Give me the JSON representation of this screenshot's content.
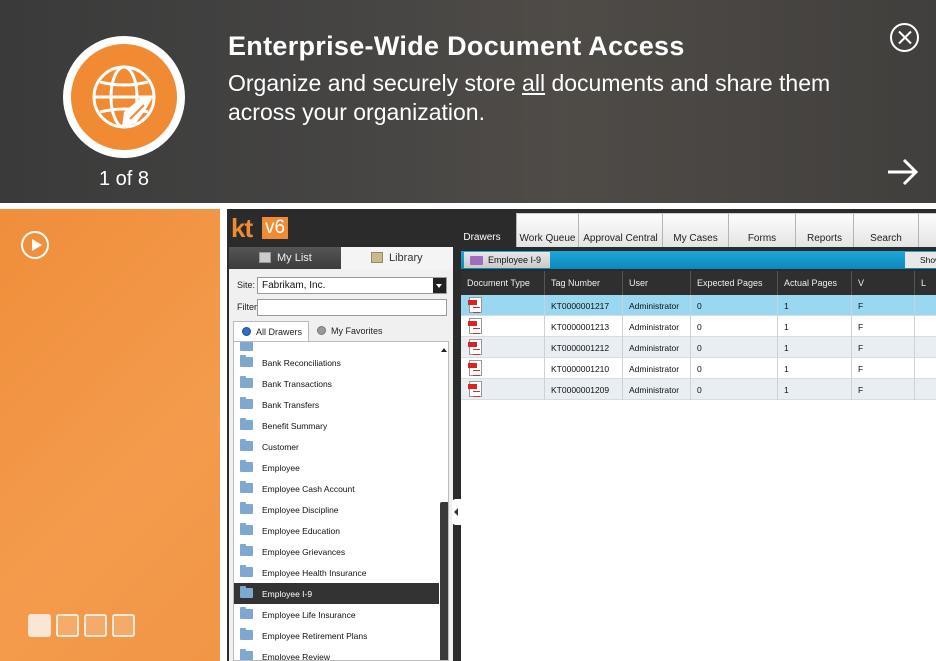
{
  "banner": {
    "title": "Enterprise-Wide Document Access",
    "subtitle_before": "Organize and securely store ",
    "subtitle_underlined": "all",
    "subtitle_after": " documents and share them across your organization.",
    "counter": "1 of 8",
    "icon": "globe-hand-icon"
  },
  "colors": {
    "accent": "#f08a33",
    "banner_bg": "#454443",
    "highlight": "#1fa6d8"
  },
  "app": {
    "logo_kt": "kt",
    "logo_version": "v6",
    "nav_tabs": [
      "Drawers",
      "Work Queue",
      "Approval Central",
      "My Cases",
      "Forms",
      "Reports",
      "Search"
    ],
    "left_tabs": [
      "My List",
      "Library"
    ],
    "site_label": "Site:",
    "site_value": "Fabrikam, Inc.",
    "filter_label": "Filter:",
    "drawer_tabs": [
      "All Drawers",
      "My Favorites"
    ],
    "drawers": [
      "Bank Reconciliations",
      "Bank Transactions",
      "Bank Transfers",
      "Benefit Summary",
      "Customer",
      "Employee",
      "Employee Cash Account",
      "Employee Discipline",
      "Employee Education",
      "Employee Grievances",
      "Employee Health Insurance",
      "Employee I-9",
      "Employee Life Insurance",
      "Employee Retirement Plans",
      "Employee Review"
    ],
    "selected_drawer": "Employee I-9",
    "doc_tab": "Employee I-9",
    "show_button": "Show",
    "columns": [
      "Document Type",
      "Tag Number",
      "User",
      "Expected Pages",
      "Actual Pages",
      "V",
      "L"
    ],
    "rows": [
      {
        "tag": "KT0000001217",
        "user": "Administrator",
        "expected": "0",
        "actual": "1",
        "v": "F"
      },
      {
        "tag": "KT0000001213",
        "user": "Administrator",
        "expected": "0",
        "actual": "1",
        "v": "F"
      },
      {
        "tag": "KT0000001212",
        "user": "Administrator",
        "expected": "0",
        "actual": "1",
        "v": "F"
      },
      {
        "tag": "KT0000001210",
        "user": "Administrator",
        "expected": "0",
        "actual": "1",
        "v": "F"
      },
      {
        "tag": "KT0000001209",
        "user": "Administrator",
        "expected": "0",
        "actual": "1",
        "v": "F"
      }
    ]
  },
  "pagination": {
    "dots": 4,
    "active": 0
  }
}
